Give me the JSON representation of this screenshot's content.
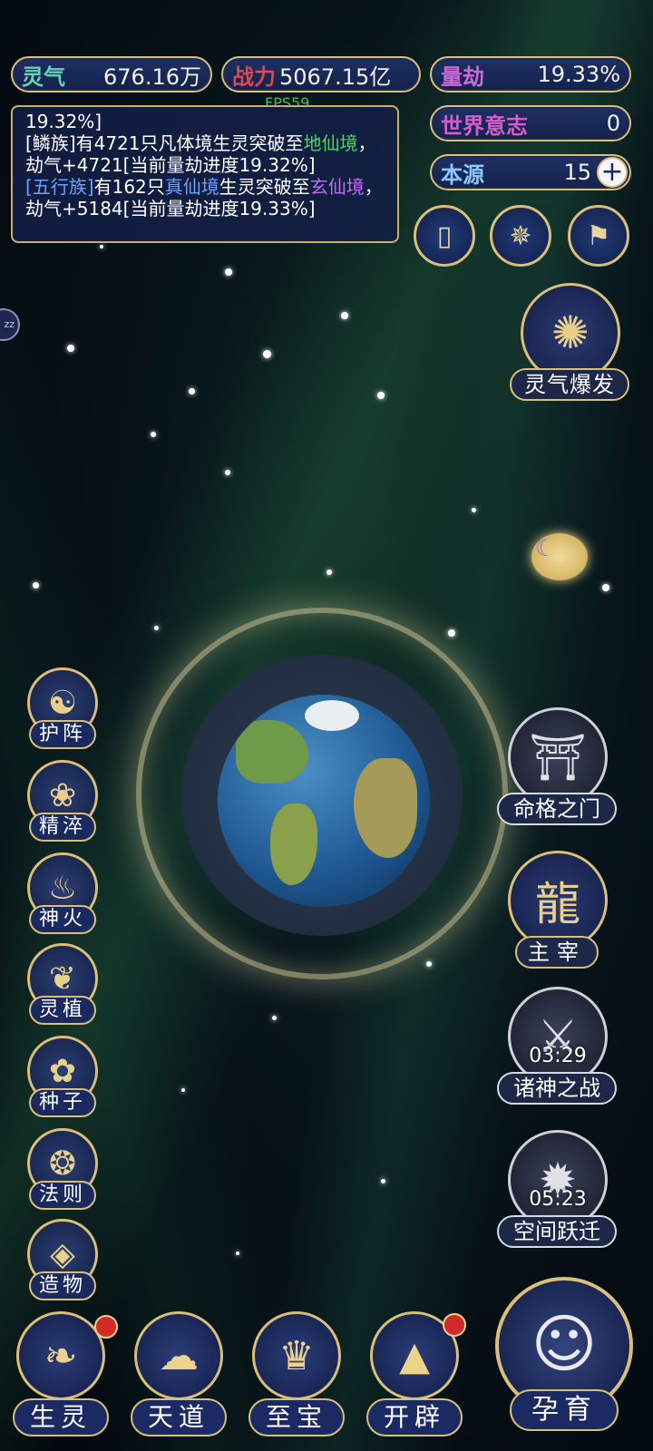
{
  "stats": {
    "lingqi": {
      "label": "灵气",
      "value": "676.16万"
    },
    "zhanli": {
      "label": "战力",
      "value": "5067.15亿"
    },
    "liangjie": {
      "label": "量劫",
      "value": "19.33%"
    },
    "shijie": {
      "label": "世界意志",
      "value": "0"
    },
    "benyuan": {
      "label": "本源",
      "value": "15"
    }
  },
  "fps": "FPS59",
  "log": {
    "line0": "19.32%]",
    "e1": {
      "a": "[鳞族]有4721只凡体境生灵突破至",
      "b": "地仙",
      "c": "境",
      "d": "，劫气+4721[当前量劫进度19.32%]"
    },
    "e2": {
      "a": "[五行族]",
      "b": "有162只",
      "c": "真仙境",
      "d": "生灵突破至",
      "e": "玄仙",
      "f": "境",
      "g": "，劫气+5184[当前量劫进度19.33%]"
    }
  },
  "right_buttons": {
    "burst": "灵气爆发",
    "fate_gate": "命格之门",
    "master": "主宰",
    "gods_war": {
      "label": "诸神之战",
      "timer": "03:29"
    },
    "space_jump": {
      "label": "空间跃迁",
      "timer": "05:23"
    }
  },
  "left_buttons": [
    "护阵",
    "精淬",
    "神火",
    "灵植",
    "种子",
    "法则",
    "造物"
  ],
  "bottom_buttons": [
    "生灵",
    "天道",
    "至宝",
    "开辟",
    "孕育"
  ],
  "colors": {
    "gold": "#d9bf7a",
    "panel": "#1b2a63",
    "green_text": "#4fd36a",
    "blue_text": "#6aa2ff",
    "purple_text": "#c36bff"
  }
}
